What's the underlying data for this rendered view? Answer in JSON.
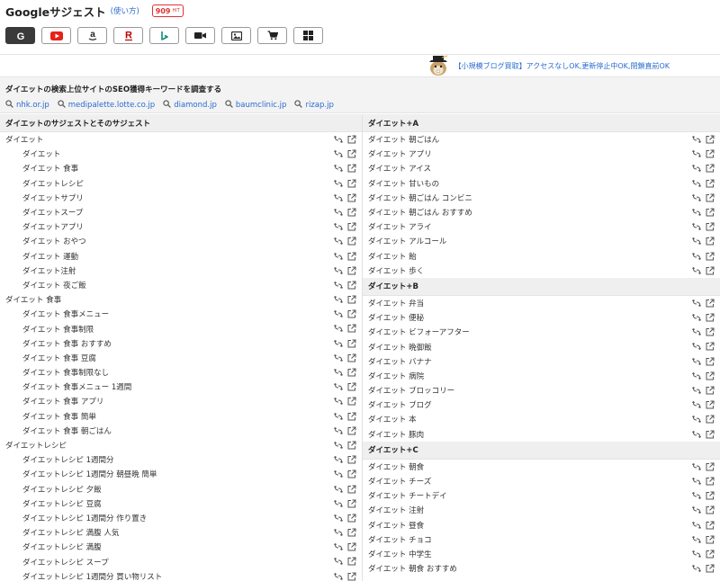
{
  "header": {
    "title": "Googleサジェスト",
    "help_label": "(使い方)",
    "hit_count": "909",
    "hit_unit": "HIT",
    "engines": [
      {
        "name": "Google",
        "icon": "google-icon",
        "active": true
      },
      {
        "name": "YouTube",
        "icon": "youtube-icon",
        "active": false
      },
      {
        "name": "Amazon",
        "icon": "amazon-icon",
        "active": false
      },
      {
        "name": "Rakuten",
        "icon": "rakuten-icon",
        "active": false
      },
      {
        "name": "Bing",
        "icon": "bing-icon",
        "active": false
      },
      {
        "name": "Video",
        "icon": "video-icon",
        "active": false
      },
      {
        "name": "Image",
        "icon": "image-icon",
        "active": false
      },
      {
        "name": "Shopping",
        "icon": "cart-icon",
        "active": false
      },
      {
        "name": "Apps",
        "icon": "grid-icon",
        "active": false
      }
    ]
  },
  "promo": {
    "text": "【小規模ブログ買取】アクセスなしOK,更新停止中OK,閉鎖直前OK",
    "icon": "beaver-mascot-icon"
  },
  "sites": {
    "title": "ダイエットの検索上位サイトのSEO獲得キーワードを調査する",
    "links": [
      "nhk.or.jp",
      "medipalette.lotte.co.jp",
      "diamond.jp",
      "baumclinic.jp",
      "rizap.jp"
    ]
  },
  "left": {
    "heading": "ダイエットのサジェストとそのサジェスト",
    "groups": [
      {
        "label": "ダイエット",
        "items": [
          "ダイエット",
          "ダイエット 食事",
          "ダイエットレシピ",
          "ダイエットサプリ",
          "ダイエットスープ",
          "ダイエットアプリ",
          "ダイエット おやつ",
          "ダイエット 運動",
          "ダイエット注射",
          "ダイエット 夜ご飯"
        ]
      },
      {
        "label": "ダイエット 食事",
        "items": [
          "ダイエット 食事メニュー",
          "ダイエット 食事制限",
          "ダイエット 食事 おすすめ",
          "ダイエット 食事 豆腐",
          "ダイエット 食事制限なし",
          "ダイエット 食事メニュー 1週間",
          "ダイエット 食事 アプリ",
          "ダイエット 食事 簡単",
          "ダイエット 食事 朝ごはん"
        ]
      },
      {
        "label": "ダイエットレシピ",
        "items": [
          "ダイエットレシピ 1週間分",
          "ダイエットレシピ 1週間分 朝昼晩 簡単",
          "ダイエットレシピ 夕飯",
          "ダイエットレシピ 豆腐",
          "ダイエットレシピ 1週間分 作り置き",
          "ダイエットレシピ 満腹 人気",
          "ダイエットレシピ 満腹",
          "ダイエットレシピ スープ",
          "ダイエットレシピ 1週間分 買い物リスト"
        ]
      }
    ]
  },
  "right": {
    "sections": [
      {
        "heading": "ダイエット+A",
        "items": [
          "ダイエット 朝ごはん",
          "ダイエット アプリ",
          "ダイエット アイス",
          "ダイエット 甘いもの",
          "ダイエット 朝ごはん コンビニ",
          "ダイエット 朝ごはん おすすめ",
          "ダイエット アライ",
          "ダイエット アルコール",
          "ダイエット 飴",
          "ダイエット 歩く"
        ]
      },
      {
        "heading": "ダイエット+B",
        "items": [
          "ダイエット 弁当",
          "ダイエット 便秘",
          "ダイエット ビフォーアフター",
          "ダイエット 晩御飯",
          "ダイエット バナナ",
          "ダイエット 病院",
          "ダイエット ブロッコリー",
          "ダイエット ブログ",
          "ダイエット 本",
          "ダイエット 豚肉"
        ]
      },
      {
        "heading": "ダイエット+C",
        "items": [
          "ダイエット 朝食",
          "ダイエット チーズ",
          "ダイエット チートデイ",
          "ダイエット 注射",
          "ダイエット 昼食",
          "ダイエット チョコ",
          "ダイエット 中学生",
          "ダイエット 朝食 おすすめ"
        ]
      }
    ]
  },
  "row_icons": [
    "swap-search-icon",
    "external-link-icon"
  ],
  "colors": {
    "link": "#2a6ad0",
    "badge": "#dd3333",
    "youtube": "#e62117",
    "rakuten": "#bf0000",
    "bing": "#0e8a7a"
  }
}
